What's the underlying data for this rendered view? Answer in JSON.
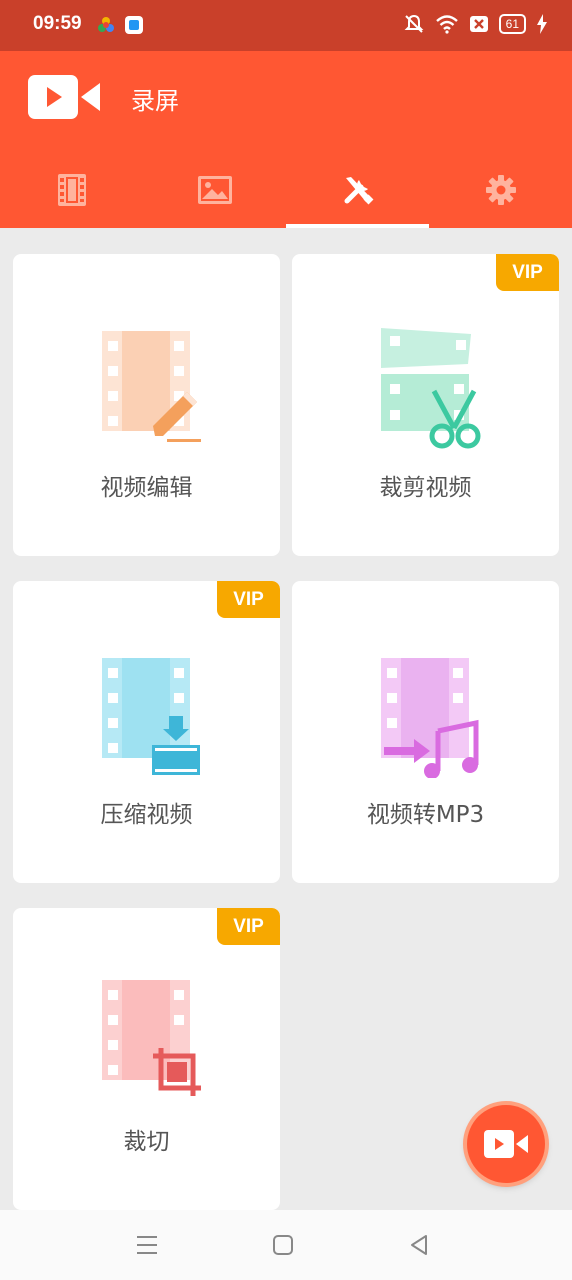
{
  "status_bar": {
    "time": "09:59",
    "battery": "61"
  },
  "app": {
    "title": "录屏"
  },
  "tabs": [
    {
      "icon": "film-icon",
      "active": false
    },
    {
      "icon": "image-icon",
      "active": false
    },
    {
      "icon": "tools-icon",
      "active": true
    },
    {
      "icon": "gear-icon",
      "active": false
    }
  ],
  "cards": [
    {
      "label": "视频编辑",
      "vip": false,
      "icon": "video-edit-icon"
    },
    {
      "label": "裁剪视频",
      "vip": true,
      "vip_label": "VIP",
      "icon": "video-trim-icon"
    },
    {
      "label": "压缩视频",
      "vip": true,
      "vip_label": "VIP",
      "icon": "video-compress-icon"
    },
    {
      "label": "视频转MP3",
      "vip": false,
      "icon": "video-to-mp3-icon"
    },
    {
      "label": "裁切",
      "vip": true,
      "vip_label": "VIP",
      "icon": "crop-icon"
    }
  ],
  "colors": {
    "status_bar": "#c9402a",
    "app_bar": "#ff5733",
    "vip": "#f7a800",
    "background": "#ebebeb"
  }
}
